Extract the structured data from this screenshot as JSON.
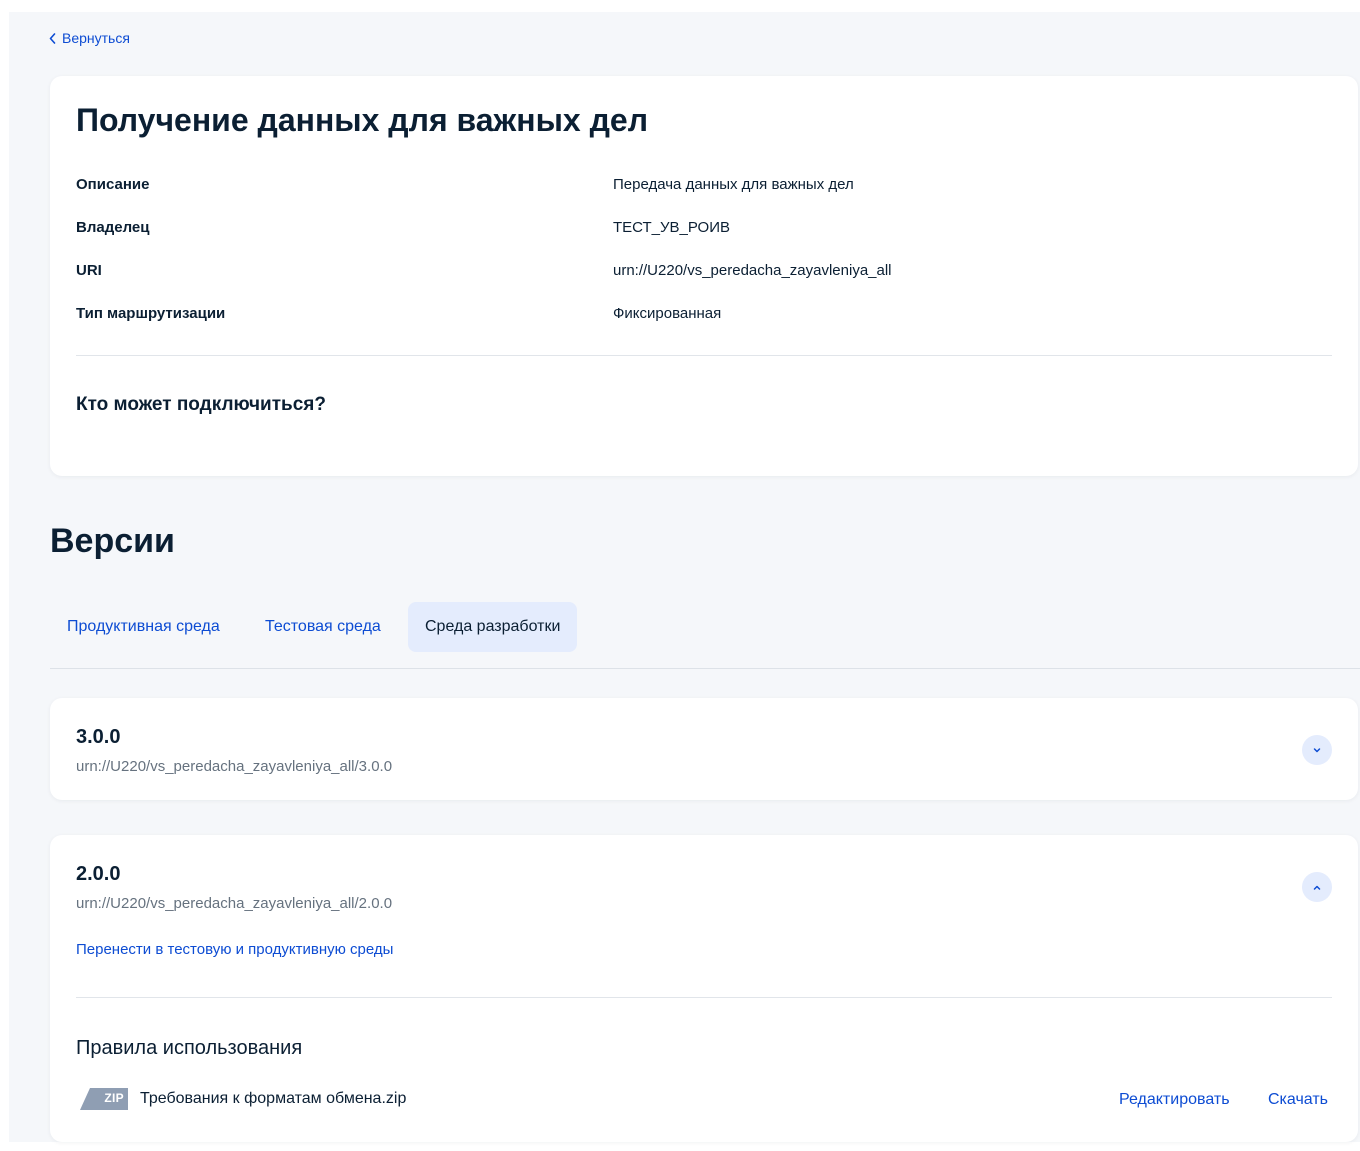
{
  "nav": {
    "back_label": "Вернуться"
  },
  "service": {
    "title": "Получение данных для важных дел",
    "details": [
      {
        "key": "Описание",
        "value": "Передача данных для важных дел"
      },
      {
        "key": "Владелец",
        "value": "ТЕСТ_УВ_РОИВ"
      },
      {
        "key": "URI",
        "value": "urn://U220/vs_peredacha_zayavleniya_all"
      },
      {
        "key": "Тип маршрутизации",
        "value": "Фиксированная"
      }
    ],
    "who_can_connect": "Кто может подключиться?"
  },
  "versions": {
    "title": "Версии",
    "tabs": [
      {
        "label": "Продуктивная среда",
        "active": false
      },
      {
        "label": "Тестовая среда",
        "active": false
      },
      {
        "label": "Среда разработки",
        "active": true
      }
    ],
    "items": [
      {
        "number": "3.0.0",
        "uri": "urn://U220/vs_peredacha_zayavleniya_all/3.0.0",
        "expanded": false
      },
      {
        "number": "2.0.0",
        "uri": "urn://U220/vs_peredacha_zayavleniya_all/2.0.0",
        "expanded": true,
        "transfer_link": "Перенести в тестовую и продуктивную среды",
        "rules_title": "Правила использования",
        "file": {
          "badge": "ZIP",
          "name": "Требования к форматам обмена.zip",
          "edit_label": "Редактировать",
          "download_label": "Скачать"
        }
      }
    ]
  },
  "colors": {
    "link": "#0d4cd3",
    "text": "#0b1f33",
    "muted": "#66727f",
    "tab_active_bg": "#e4ecfd",
    "page_bg": "#f5f7fa",
    "zip_badge": "#8f9eb3"
  },
  "icons": {
    "back": "chevron-left-icon",
    "collapsed": "chevron-down-icon",
    "expanded": "chevron-up-icon",
    "file": "zip-file-icon"
  }
}
